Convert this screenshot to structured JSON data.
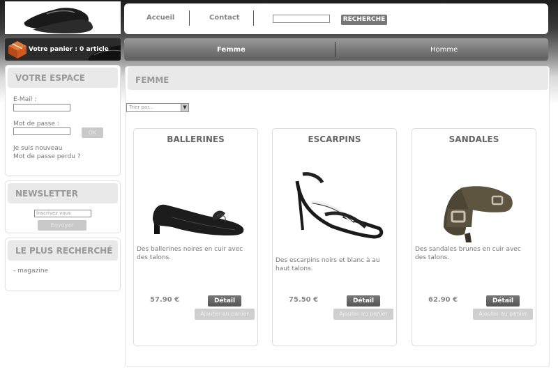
{
  "header": {
    "nav": [
      "Accueil",
      "Contact"
    ],
    "search_button": "RECHERCHE"
  },
  "cart": {
    "label": "Votre panier : 0 article"
  },
  "gender_nav": [
    "Femme",
    "Homme"
  ],
  "sidebar": {
    "account": {
      "title": "VOTRE ESPACE",
      "email_label": "E-Mail :",
      "password_label": "Mot de passe :",
      "ok_label": "OK",
      "new_user_link": "Je suis nouveau",
      "forgot_link": "Mot de passe perdu ?"
    },
    "newsletter": {
      "title": "NEWSLETTER",
      "placeholder": "Inscrivez vous",
      "send_label": "Envoyer"
    },
    "popular": {
      "title": "LE PLUS RECHERCHÉ",
      "items": [
        "- magazine"
      ]
    }
  },
  "main": {
    "title": "FEMME",
    "sort_placeholder": "Trier par..."
  },
  "products": [
    {
      "name": "BALLERINES",
      "description": "Des ballerines noires en cuir avec des talons.",
      "price": "57.90 €",
      "detail_label": "Détail",
      "add_label": "Ajouter au panier"
    },
    {
      "name": "ESCARPINS",
      "description": "Des escarpins noirs et blanc à au haut talons.",
      "price": "75.50 €",
      "detail_label": "Détail",
      "add_label": "Ajouter au panier"
    },
    {
      "name": "SANDALES",
      "description": "Des sandales brunes en cuir avec des talons.",
      "price": "62.90 €",
      "detail_label": "Détail",
      "add_label": "Ajouter au panier"
    }
  ]
}
